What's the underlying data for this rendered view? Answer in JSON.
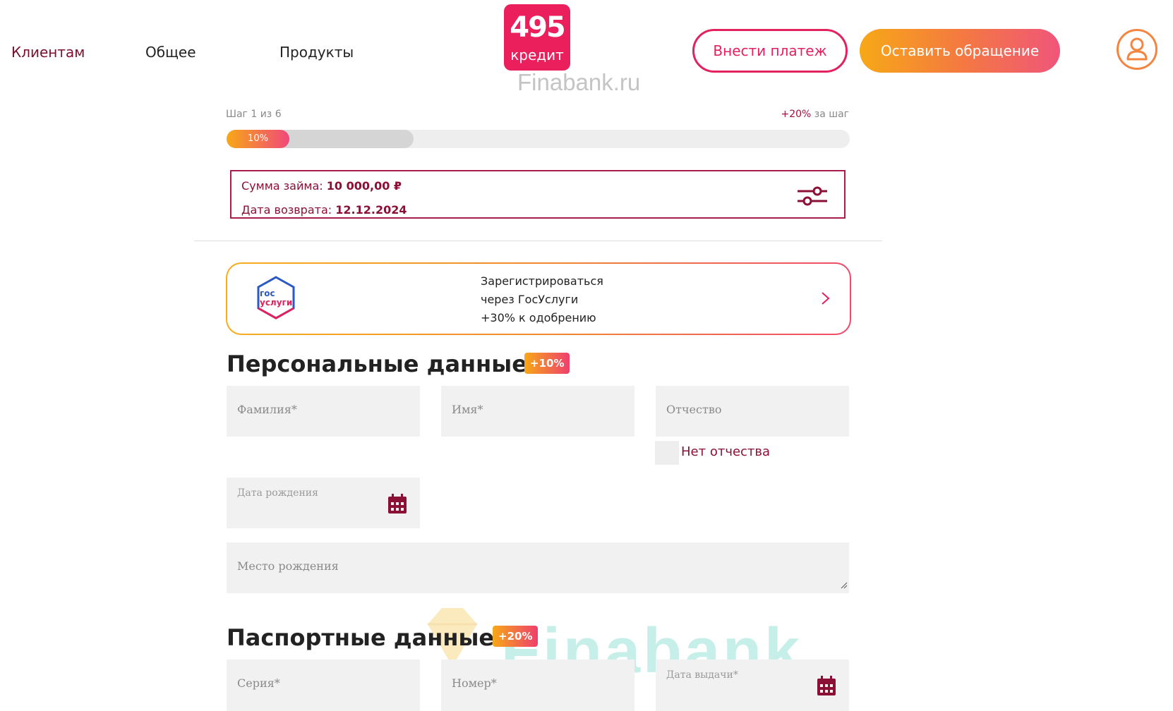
{
  "header": {
    "nav": [
      "Клиентам",
      "Общее",
      "Продукты"
    ],
    "logo": {
      "number": "495",
      "word": "кредит"
    },
    "watermark": "Finabank.ru",
    "pay_button": "Внести платеж",
    "appeal_button": "Оставить обращение",
    "user_icon": "user-icon"
  },
  "progress": {
    "step_label": "Шаг 1 из 6",
    "bonus_pct": "+20%",
    "bonus_text": " за шаг",
    "fill_label": "10%",
    "value": 0.1
  },
  "loan": {
    "amount_label": "Сумма займа:",
    "amount_value": "10 000,00 ₽",
    "date_label": "Дата возврата:",
    "date_value": "12.12.2024"
  },
  "gosuslugi": {
    "logo_line1": "гос",
    "logo_line2": "услуги",
    "line1": "Зарегистрироваться",
    "line2": "через ГосУслуги",
    "line3": "+30% к одобрению"
  },
  "personal": {
    "title": "Персональные данные",
    "badge": "+10%",
    "surname": "Фамилия*",
    "name": "Имя*",
    "patronymic": "Отчество",
    "no_patronymic": "Нет отчества",
    "birth_date": "Дата рождения",
    "birth_place": "Место рождения"
  },
  "passport": {
    "title": "Паспортные данные",
    "badge": "+20%",
    "series": "Серия*",
    "number": "Номер*",
    "issue_date": "Дата выдачи*"
  },
  "watermark_bottom": "Finabank",
  "colors": {
    "accent": "#e2215e",
    "dark_accent": "#8b1036",
    "orange": "#f7a817"
  }
}
